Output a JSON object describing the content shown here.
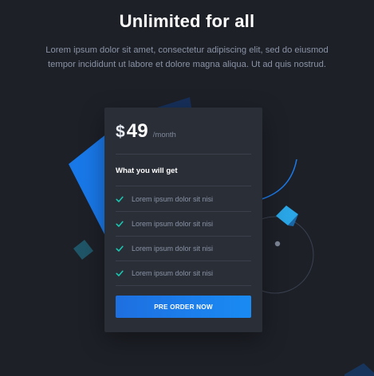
{
  "header": {
    "title": "Unlimited for all",
    "subtitle": "Lorem ipsum dolor sit amet, consectetur adipiscing elit, sed do eiusmod tempor incididunt ut labore et dolore magna aliqua. Ut ad quis nostrud."
  },
  "pricing": {
    "currency": "$",
    "amount": "49",
    "period": "/month",
    "features_title": "What you will get",
    "features": [
      "Lorem ipsum dolor sit nisi",
      "Lorem ipsum dolor sit nisi",
      "Lorem ipsum dolor sit nisi",
      "Lorem ipsum dolor sit nisi"
    ],
    "cta_label": "PRE ORDER NOW"
  },
  "colors": {
    "background": "#1d2027",
    "card": "#2a2e37",
    "accent": "#1a7ff0",
    "check": "#1bc7b1"
  },
  "icons": {
    "check": "check-icon"
  }
}
